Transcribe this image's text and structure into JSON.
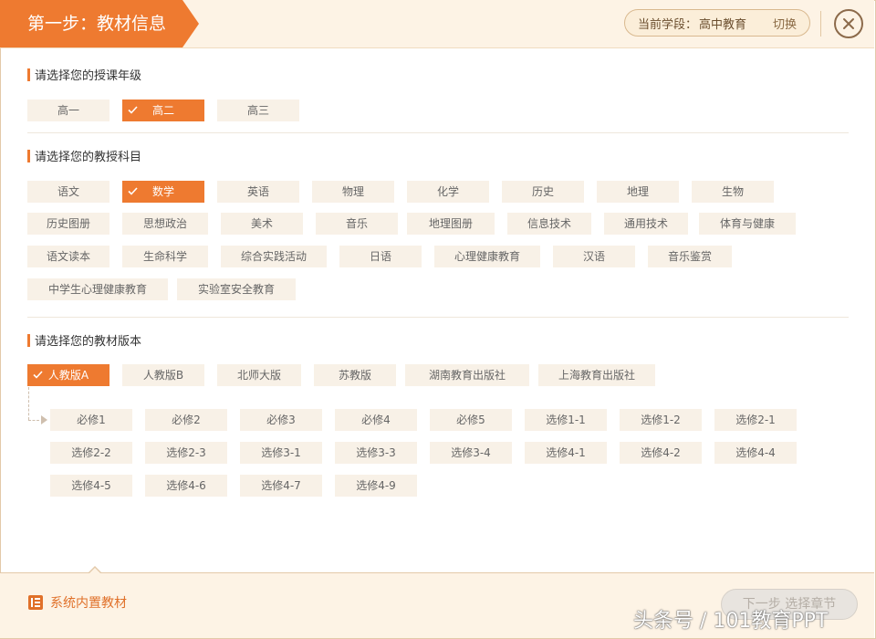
{
  "header": {
    "step_title": "第一步：教材信息",
    "stage_label": "当前学段：",
    "stage_value": "高中教育",
    "switch_label": "切换",
    "accent": "#ee7a30"
  },
  "grade_section": {
    "title": "请选择您的授课年级",
    "items": [
      {
        "label": "高一",
        "selected": false
      },
      {
        "label": "高二",
        "selected": true
      },
      {
        "label": "高三",
        "selected": false
      }
    ]
  },
  "subject_section": {
    "title": "请选择您的教授科目",
    "items": [
      {
        "label": "语文"
      },
      {
        "label": "数学",
        "selected": true
      },
      {
        "label": "英语"
      },
      {
        "label": "物理"
      },
      {
        "label": "化学"
      },
      {
        "label": "历史"
      },
      {
        "label": "地理"
      },
      {
        "label": "生物"
      },
      {
        "label": "历史图册"
      },
      {
        "label": "思想政治"
      },
      {
        "label": "美术"
      },
      {
        "label": "音乐"
      },
      {
        "label": "地理图册"
      },
      {
        "label": "信息技术"
      },
      {
        "label": "通用技术"
      },
      {
        "label": "体育与健康"
      },
      {
        "label": "语文读本"
      },
      {
        "label": "生命科学"
      },
      {
        "label": "综合实践活动"
      },
      {
        "label": "日语"
      },
      {
        "label": "心理健康教育"
      },
      {
        "label": "汉语"
      },
      {
        "label": "音乐鉴赏"
      },
      {
        "label": "中学生心理健康教育"
      },
      {
        "label": "实验室安全教育"
      }
    ]
  },
  "edition_section": {
    "title": "请选择您的教材版本",
    "items": [
      {
        "label": "人教版A",
        "selected": true
      },
      {
        "label": "人教版B"
      },
      {
        "label": "北师大版"
      },
      {
        "label": "苏教版"
      },
      {
        "label": "湖南教育出版社"
      },
      {
        "label": "上海教育出版社"
      }
    ]
  },
  "volumes": {
    "items": [
      "必修1",
      "必修2",
      "必修3",
      "必修4",
      "必修5",
      "选修1-1",
      "选修1-2",
      "选修2-1",
      "选修2-2",
      "选修2-3",
      "选修3-1",
      "选修3-3",
      "选修3-4",
      "选修4-1",
      "选修4-2",
      "选修4-4",
      "选修4-5",
      "选修4-6",
      "选修4-7",
      "选修4-9"
    ]
  },
  "footer": {
    "builtin_label": "系统内置教材",
    "next_label": "下一步 选择章节",
    "watermark": "头条号 / 101教育PPT"
  }
}
